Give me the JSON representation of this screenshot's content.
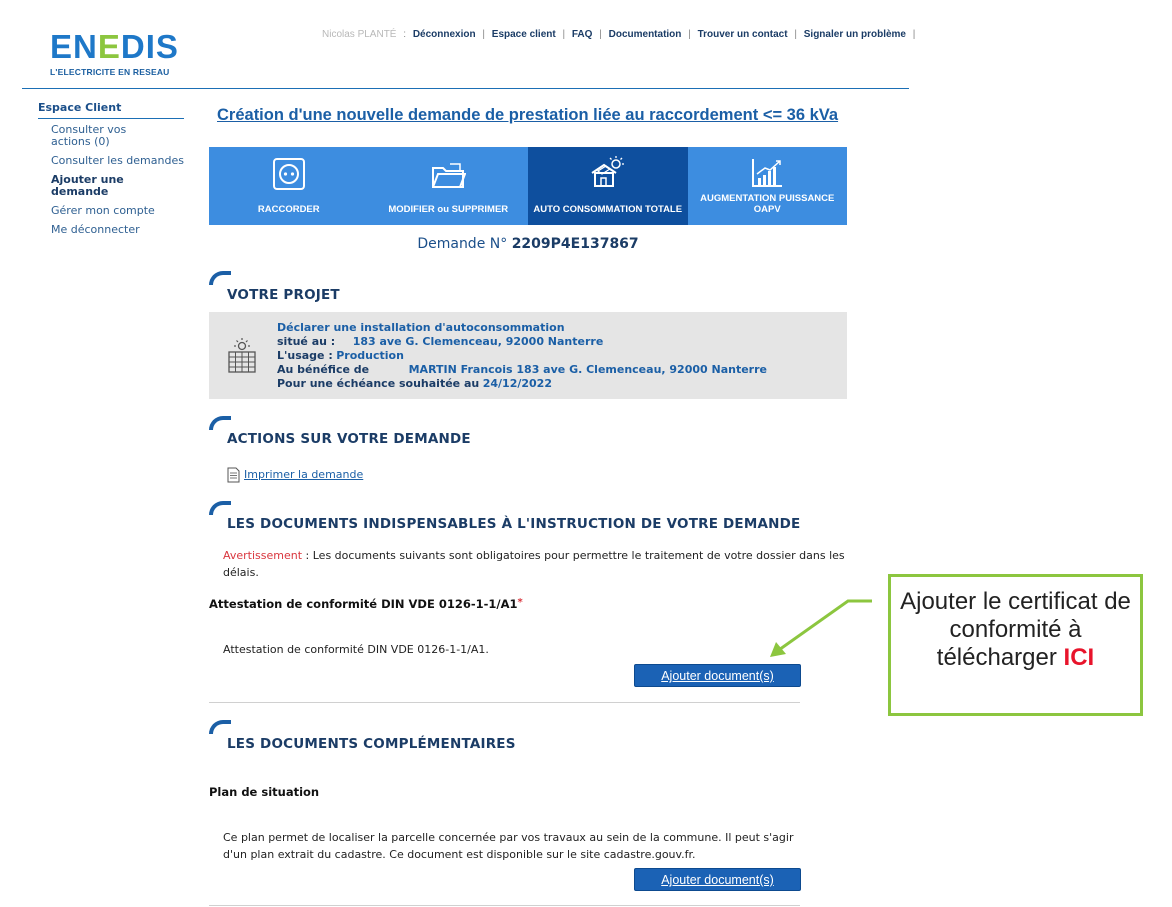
{
  "brand": {
    "name": "ENEDIS",
    "tagline": "L'ELECTRICITE EN RESEAU"
  },
  "topnav": {
    "user": "Nicolas PLANTÉ",
    "links": [
      "Déconnexion",
      "Espace client",
      "FAQ",
      "Documentation",
      "Trouver un contact",
      "Signaler un problème"
    ]
  },
  "sidebar": {
    "title": "Espace Client",
    "items": [
      {
        "label": "Consulter vos actions (0)"
      },
      {
        "label": "Consulter les demandes"
      },
      {
        "label": "Ajouter une demande",
        "active": true
      },
      {
        "label": "Gérer mon compte"
      },
      {
        "label": "Me déconnecter"
      }
    ]
  },
  "page_title": "Création d'une nouvelle demande de prestation liée au raccordement <= 36 kVa",
  "tabs": [
    {
      "label": "RACCORDER",
      "icon": "socket-icon"
    },
    {
      "label": "MODIFIER ou SUPPRIMER",
      "icon": "folder-icon"
    },
    {
      "label": "AUTO CONSOMMATION TOTALE",
      "icon": "solar-house-icon",
      "active": true
    },
    {
      "label": "AUGMENTATION PUISSANCE OAPV",
      "icon": "growth-chart-icon"
    }
  ],
  "demande": {
    "prefix": "Demande N°",
    "number": "2209P4E137867"
  },
  "projet": {
    "title": "VOTRE PROJET",
    "heading": "Déclarer une installation d'autoconsommation",
    "situe_label": "situé au :",
    "situe_value": "183 ave G. Clemenceau, 92000 Nanterre",
    "usage_label": "L'usage :",
    "usage_value": "Production",
    "benef_label": "Au bénéfice de",
    "benef_value": "MARTIN Francois 183 ave G. Clemenceau, 92000 Nanterre",
    "echeance_label": "Pour une échéance souhaitée au",
    "echeance_value": "24/12/2022"
  },
  "actions": {
    "title": "ACTIONS SUR VOTRE DEMANDE",
    "print_label": "Imprimer la demande"
  },
  "docs_required": {
    "title": "LES DOCUMENTS INDISPENSABLES À L'INSTRUCTION DE VOTRE DEMANDE",
    "warning_label": "Avertissement",
    "warning_text": " : Les documents suivants sont obligatoires pour permettre le traitement de votre dossier dans les délais.",
    "doc_label": "Attestation de conformité DIN VDE 0126-1-1/A1",
    "doc_star": "*",
    "doc_desc": "Attestation de conformité DIN VDE 0126-1-1/A1.",
    "button_label": "Ajouter document(s)"
  },
  "docs_extra": {
    "title": "LES DOCUMENTS COMPLÉMENTAIRES",
    "doc_label": "Plan de situation",
    "doc_desc": "Ce plan permet de localiser la parcelle concernée par vos travaux au sein de la commune. Il peut s'agir d'un plan extrait du cadastre. Ce document est disponible sur le site cadastre.gouv.fr.",
    "button_label": "Ajouter document(s)"
  },
  "callout": {
    "text": "Ajouter le certificat de conformité à télécharger",
    "highlight": "ICI",
    "colors": {
      "border": "#8cc63f",
      "highlight": "#e8142b"
    }
  },
  "colors": {
    "brand_blue": "#1e78c8",
    "brand_green": "#8cc63f",
    "tab": "#3d8de0",
    "tab_active": "#0e4f9e",
    "button": "#1b62b5"
  }
}
